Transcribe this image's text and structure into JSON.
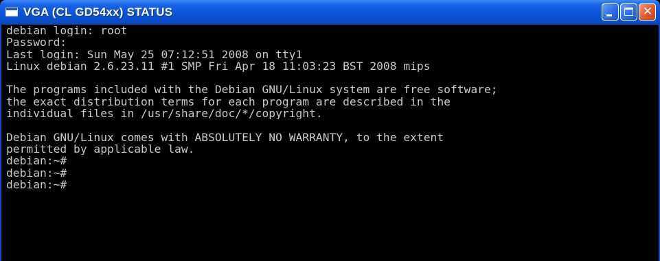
{
  "window": {
    "title": "VGA (CL GD54xx) STATUS",
    "icon": "console-window-icon",
    "controls": {
      "minimize_icon": "minimize-icon",
      "maximize_icon": "maximize-icon",
      "close_icon": "close-icon",
      "close_glyph": "✕"
    }
  },
  "terminal": {
    "foreground": "#c8c8c8",
    "background": "#000000",
    "lines": [
      "debian login: root",
      "Password:",
      "Last login: Sun May 25 07:12:51 2008 on tty1",
      "Linux debian 2.6.23.11 #1 SMP Fri Apr 18 11:03:23 BST 2008 mips",
      "",
      "The programs included with the Debian GNU/Linux system are free software;",
      "the exact distribution terms for each program are described in the",
      "individual files in /usr/share/doc/*/copyright.",
      "",
      "Debian GNU/Linux comes with ABSOLUTELY NO WARRANTY, to the extent",
      "permitted by applicable law.",
      "debian:~#",
      "debian:~#",
      "debian:~#"
    ]
  },
  "colors": {
    "titlebar": "#0a54d6",
    "close_button": "#e05a2c"
  }
}
